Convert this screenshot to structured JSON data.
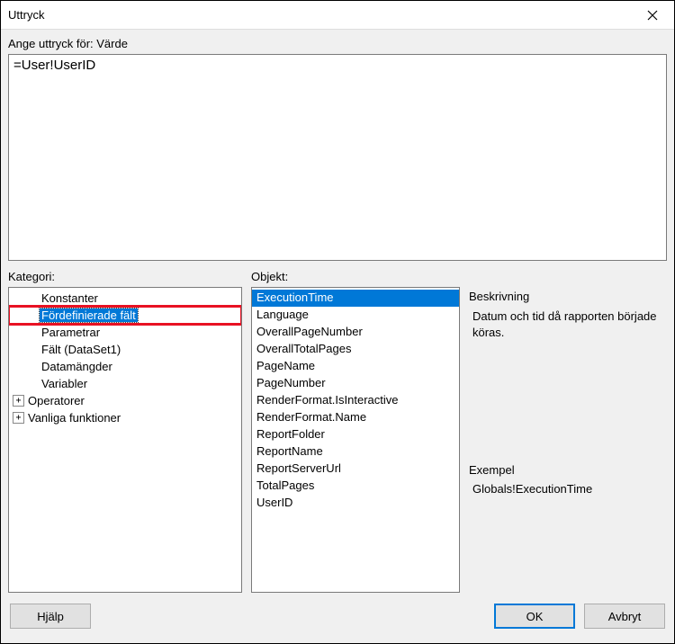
{
  "window": {
    "title": "Uttryck"
  },
  "field_label": "Ange uttryck för: Värde",
  "expression_value": "=User!UserID",
  "category": {
    "label": "Kategori:",
    "items": [
      {
        "label": "Konstanter",
        "indent": 1,
        "expand": "none"
      },
      {
        "label": "Fördefinierade fält",
        "indent": 1,
        "expand": "none",
        "selected": true,
        "highlighted": true
      },
      {
        "label": "Parametrar",
        "indent": 1,
        "expand": "none"
      },
      {
        "label": "Fält (DataSet1)",
        "indent": 1,
        "expand": "none"
      },
      {
        "label": "Datamängder",
        "indent": 1,
        "expand": "none"
      },
      {
        "label": "Variabler",
        "indent": 1,
        "expand": "none"
      },
      {
        "label": "Operatorer",
        "indent": 0,
        "expand": "plus"
      },
      {
        "label": "Vanliga funktioner",
        "indent": 0,
        "expand": "plus"
      }
    ]
  },
  "object": {
    "label": "Objekt:",
    "items": [
      {
        "label": "ExecutionTime",
        "selected": true
      },
      {
        "label": "Language"
      },
      {
        "label": "OverallPageNumber"
      },
      {
        "label": "OverallTotalPages"
      },
      {
        "label": "PageName"
      },
      {
        "label": "PageNumber"
      },
      {
        "label": "RenderFormat.IsInteractive"
      },
      {
        "label": "RenderFormat.Name"
      },
      {
        "label": "ReportFolder"
      },
      {
        "label": "ReportName"
      },
      {
        "label": "ReportServerUrl"
      },
      {
        "label": "TotalPages"
      },
      {
        "label": "UserID"
      }
    ]
  },
  "description": {
    "heading": "Beskrivning",
    "text": "Datum och tid då rapporten började köras."
  },
  "example": {
    "heading": "Exempel",
    "text": "Globals!ExecutionTime"
  },
  "buttons": {
    "help": "Hjälp",
    "ok": "OK",
    "cancel": "Avbryt"
  }
}
